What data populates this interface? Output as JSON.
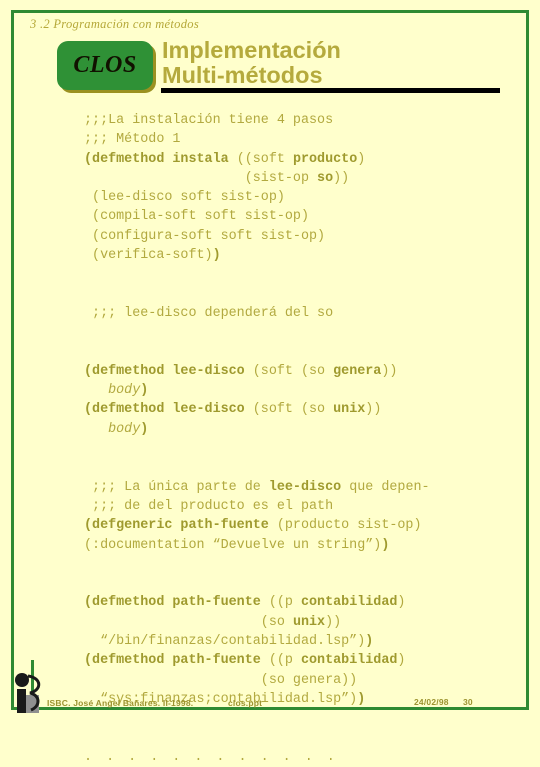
{
  "slide": {
    "section_label": "3 .2 Programación con métodos",
    "badge_label": "CLOS",
    "title_line1": "Implementación",
    "title_line2": "Multi-métodos"
  },
  "colors": {
    "background": "#ffffcc",
    "frame_green": "#2f8a32",
    "badge_green": "#2f9136",
    "badge_shadow": "#9b9120",
    "title_olive": "#b5aa3d",
    "code_olive": "#b2a93f",
    "code_bold_olive": "#9f9a2e",
    "rule_black": "#000000",
    "footer_olive": "#9c9330"
  },
  "code_lines": [
    {
      "id": "c01",
      "html": ";;;La instalación tiene 4 pasos"
    },
    {
      "id": "c02",
      "html": ";;; Método 1"
    },
    {
      "id": "c03",
      "html": "<b>(defmethod instala</b> ((soft <b>producto</b>)"
    },
    {
      "id": "c04",
      "html": "                    (sist-op <b>so</b>))"
    },
    {
      "id": "c05",
      "html": " (lee-disco soft sist-op)"
    },
    {
      "id": "c06",
      "html": " (compila-soft soft sist-op)"
    },
    {
      "id": "c07",
      "html": " (configura-soft soft sist-op)"
    },
    {
      "id": "c08",
      "html": " (verifica-soft)<b>)</b>"
    },
    {
      "id": "c09",
      "html": "",
      "blank": true
    },
    {
      "id": "c10",
      "html": "",
      "blank": true
    },
    {
      "id": "c11",
      "html": " ;;; lee-disco dependerá del so"
    },
    {
      "id": "c12",
      "html": "",
      "blank": true
    },
    {
      "id": "c13",
      "html": "",
      "blank": true
    },
    {
      "id": "c14",
      "html": "<b>(defmethod lee-disco</b> (soft (so <b>genera</b>))"
    },
    {
      "id": "c15",
      "html": "   <i>body</i><b>)</b>"
    },
    {
      "id": "c16",
      "html": "<b>(defmethod lee-disco</b> (soft (so <b>unix</b>))"
    },
    {
      "id": "c17",
      "html": "   <i>body</i><b>)</b>"
    },
    {
      "id": "c18",
      "html": "",
      "blank": true
    },
    {
      "id": "c19",
      "html": "",
      "blank": true
    },
    {
      "id": "c20",
      "html": " ;;; La única parte de <b>lee-disco</b> que depen-"
    },
    {
      "id": "c21",
      "html": " ;;; de del producto es el path"
    },
    {
      "id": "c22",
      "html": "<b>(defgeneric path-fuente</b> (producto sist-op)"
    },
    {
      "id": "c23",
      "html": "(:documentation “Devuelve un string”)<b>)</b>"
    },
    {
      "id": "c24",
      "html": "",
      "blank": true
    },
    {
      "id": "c25",
      "html": "",
      "blank": true
    },
    {
      "id": "c26",
      "html": "<b>(defmethod path-fuente</b> ((p <b>contabilidad</b>)"
    },
    {
      "id": "c27",
      "html": "                      (so <b>unix</b>))"
    },
    {
      "id": "c28",
      "html": "  “/bin/finanzas/contabilidad.lsp”)<b>)</b>"
    },
    {
      "id": "c29",
      "html": "<b>(defmethod path-fuente</b> ((p <b>contabilidad</b>)"
    },
    {
      "id": "c30",
      "html": "                      (so genera))"
    },
    {
      "id": "c31",
      "html": "  “sys:finanzas;contabilidad.lsp”)<b>)</b>"
    },
    {
      "id": "c32",
      "html": "",
      "blank": true
    },
    {
      "id": "c33",
      "html": "",
      "blank": true
    },
    {
      "id": "c34",
      "html": "<span class=\"dots\">. . . . . . . . . . . .</span>"
    }
  ],
  "footer": {
    "author": "ISBC. José Angel Bañares. II-1998.",
    "file": "clos.ppt",
    "date": "24/02/98",
    "page": "30",
    "logo_name": "isbc-figure-logo"
  }
}
